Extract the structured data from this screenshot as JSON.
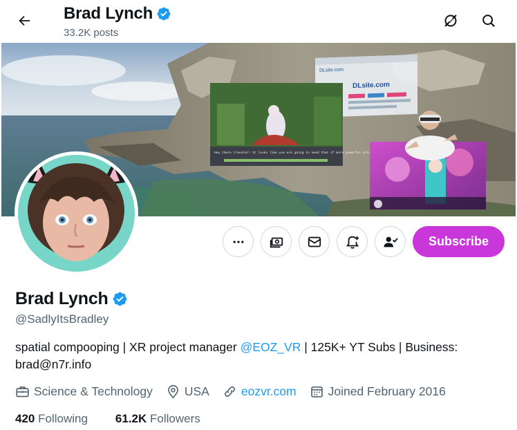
{
  "header": {
    "name": "Brad Lynch",
    "posts": "33.2K posts",
    "back_icon": "arrow-left-icon",
    "grok_icon": "grok-icon",
    "search_icon": "search-icon"
  },
  "banner": {
    "screen_small_title": "DLsite.com",
    "screen_sub_title": "DLsite.com",
    "game_dialogue": "Hey there traveler! It looks like you are going to need that if more powerful attacks"
  },
  "actions": {
    "more_icon": "more-icon",
    "tip_icon": "money-icon",
    "message_icon": "envelope-icon",
    "notify_icon": "bell-plus-icon",
    "following_icon": "person-check-icon",
    "subscribe_label": "Subscribe"
  },
  "profile": {
    "display_name": "Brad Lynch",
    "handle": "@SadlyItsBradley",
    "bio_before": "spatial compooping | XR project manager ",
    "bio_mention": "@EOZ_VR",
    "bio_after": " | 125K+ YT Subs | Business: brad@n7r.info",
    "category": "Science & Technology",
    "location": "USA",
    "website": "eozvr.com",
    "joined": "Joined February 2016",
    "following_count": "420",
    "following_label": "Following",
    "followers_count": "61.2K",
    "followers_label": "Followers"
  },
  "colors": {
    "verified": "#1d9bf0",
    "subscribe": "#c936d9",
    "link": "#1d9bf0",
    "muted": "#536471"
  }
}
